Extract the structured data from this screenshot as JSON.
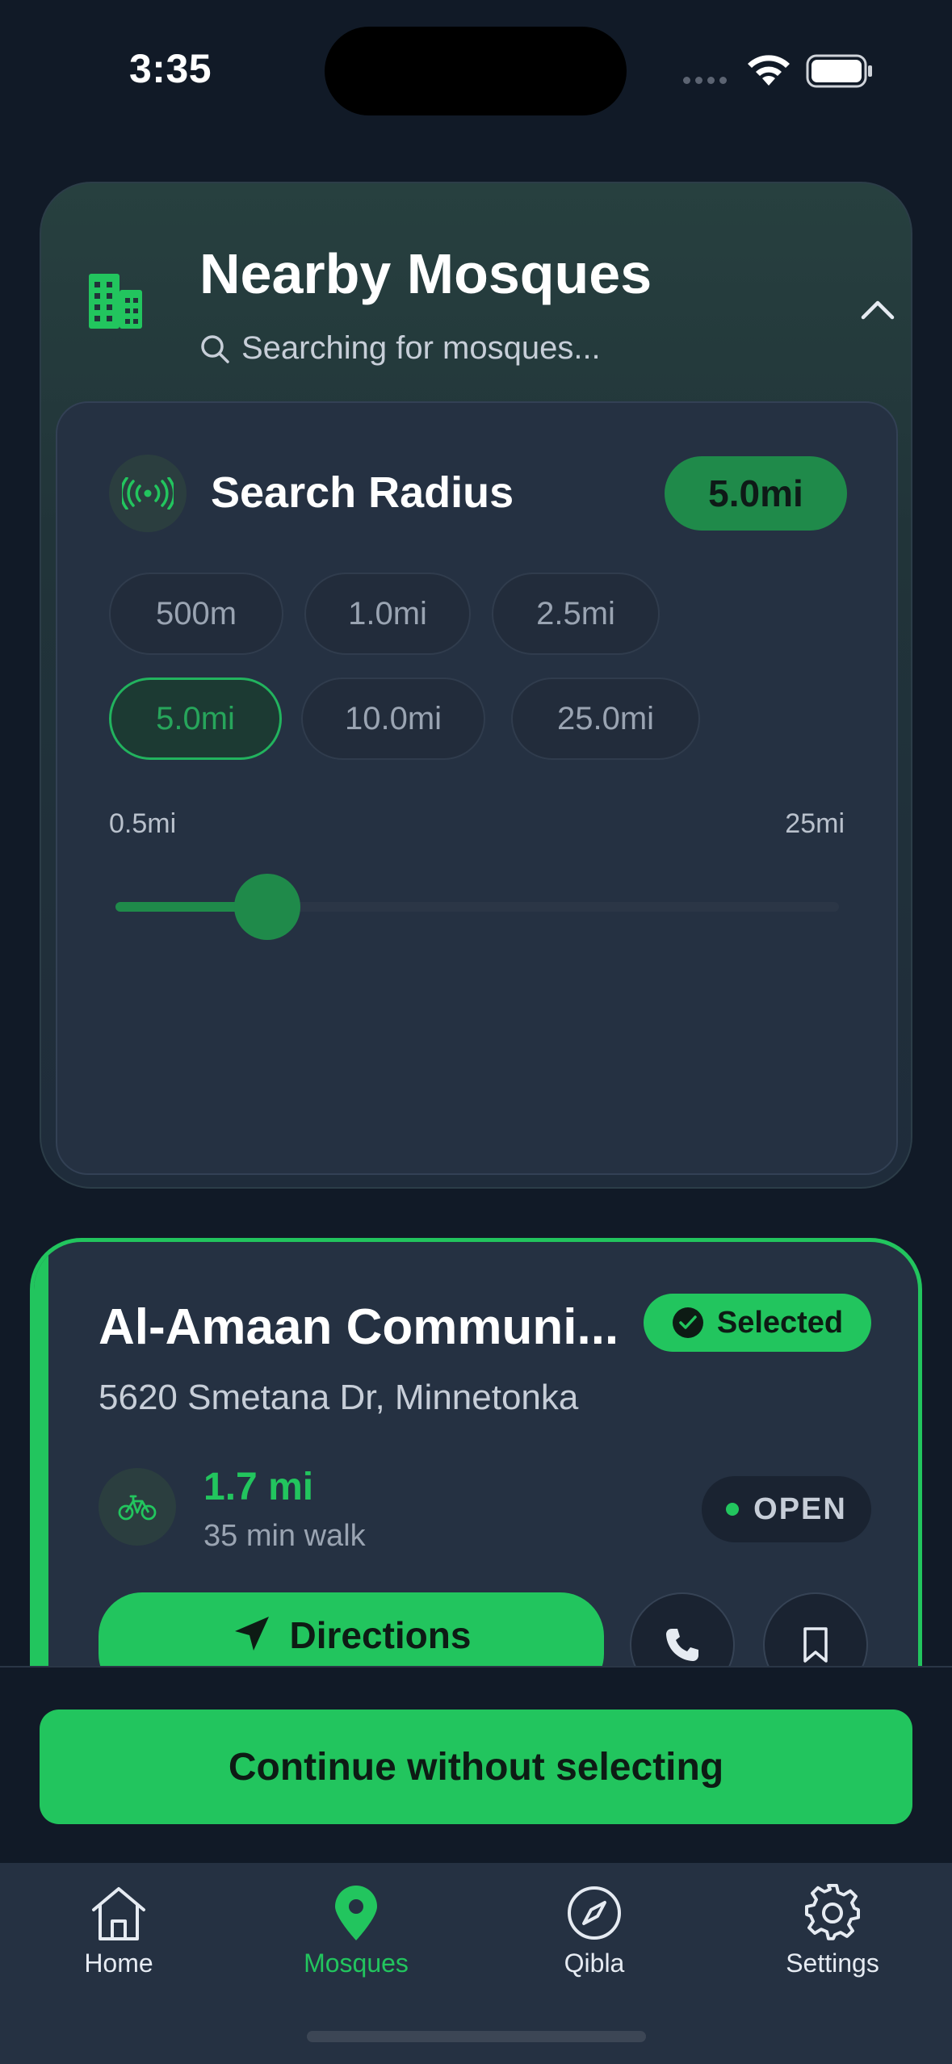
{
  "status_bar": {
    "time": "3:35"
  },
  "header": {
    "title": "Nearby Mosques",
    "search_status": "Searching for mosques...",
    "icons": {
      "building": "building-icon",
      "search": "search-icon",
      "collapse": "chevron-up-icon"
    }
  },
  "radius": {
    "label": "Search Radius",
    "current": "5.0mi",
    "options_row1": [
      "500m",
      "1.0mi",
      "2.5mi"
    ],
    "options_row2": [
      "5.0mi",
      "10.0mi",
      "25.0mi"
    ],
    "selected_option": "5.0mi",
    "min_label": "0.5mi",
    "max_label": "25mi",
    "slider_fraction": 0.21
  },
  "mosque": {
    "name": "Al-Amaan Communi...",
    "selected_label": "Selected",
    "address": "5620 Smetana Dr, Minnetonka",
    "distance": "1.7 mi",
    "walk_time": "35 min walk",
    "status": "OPEN",
    "directions_label": "Directions"
  },
  "actions": {
    "continue_label": "Continue without selecting"
  },
  "tabs": [
    {
      "label": "Home",
      "icon": "home-icon"
    },
    {
      "label": "Mosques",
      "icon": "map-pin-icon"
    },
    {
      "label": "Qibla",
      "icon": "compass-icon"
    },
    {
      "label": "Settings",
      "icon": "gear-icon"
    }
  ],
  "active_tab": "Mosques",
  "colors": {
    "accent": "#22c55e",
    "background": "#111a27",
    "card": "#253142"
  }
}
